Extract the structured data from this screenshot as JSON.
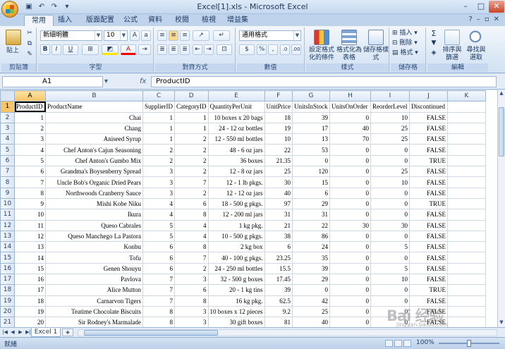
{
  "window": {
    "title": "Excel[1].xls - Microsoft Excel"
  },
  "quick_access": {
    "undo_icon": "undo-icon",
    "redo_icon": "redo-icon"
  },
  "tabs": [
    {
      "label": "常用",
      "active": true
    },
    {
      "label": "插入"
    },
    {
      "label": "版面配置"
    },
    {
      "label": "公式"
    },
    {
      "label": "資料"
    },
    {
      "label": "校閱"
    },
    {
      "label": "檢視"
    },
    {
      "label": "增益集"
    }
  ],
  "ribbon": {
    "clipboard": {
      "label": "剪貼簿",
      "paste": "貼上"
    },
    "font": {
      "label": "字型",
      "font_name": "新細明體",
      "font_size": "10"
    },
    "alignment": {
      "label": "對齊方式"
    },
    "number": {
      "label": "數值",
      "format": "通用格式"
    },
    "styles": {
      "label": "樣式",
      "conditional": "設定格式化的條件",
      "table": "格式化為表格",
      "cell_styles": "儲存格樣式"
    },
    "cells": {
      "label": "儲存格",
      "insert": "插入",
      "delete": "刪除",
      "format": "格式"
    },
    "editing": {
      "label": "編輯",
      "sort": "排序與篩選",
      "find": "尋找與選取"
    }
  },
  "formula_bar": {
    "name_box": "A1",
    "fx": "fx",
    "content": "ProductID"
  },
  "grid": {
    "columns": [
      "A",
      "B",
      "C",
      "D",
      "E",
      "F",
      "G",
      "H",
      "I",
      "J",
      "K"
    ],
    "headers": [
      "ProductID",
      "ProductName",
      "SupplierID",
      "CategoryID",
      "QuantityPerUnit",
      "UnitPrice",
      "UnitsInStock",
      "UnitsOnOrder",
      "ReorderLevel",
      "Discontinued"
    ],
    "rows": [
      [
        "1",
        "Chai",
        "1",
        "1",
        "10 boxes x 20 bags",
        "18",
        "39",
        "0",
        "10",
        "FALSE"
      ],
      [
        "2",
        "Chang",
        "1",
        "1",
        "24 - 12 oz bottles",
        "19",
        "17",
        "40",
        "25",
        "FALSE"
      ],
      [
        "3",
        "Aniseed Syrup",
        "1",
        "2",
        "12 - 550 ml bottles",
        "10",
        "13",
        "70",
        "25",
        "FALSE"
      ],
      [
        "4",
        "Chef Anton's Cajun Seasoning",
        "2",
        "2",
        "48 - 6 oz jars",
        "22",
        "53",
        "0",
        "0",
        "FALSE"
      ],
      [
        "5",
        "Chef Anton's Gumbo Mix",
        "2",
        "2",
        "36 boxes",
        "21.35",
        "0",
        "0",
        "0",
        "TRUE"
      ],
      [
        "6",
        "Grandma's Boysenberry Spread",
        "3",
        "2",
        "12 - 8 oz jars",
        "25",
        "120",
        "0",
        "25",
        "FALSE"
      ],
      [
        "7",
        "Uncle Bob's Organic Dried Pears",
        "3",
        "7",
        "12 - 1 lb pkgs.",
        "30",
        "15",
        "0",
        "10",
        "FALSE"
      ],
      [
        "8",
        "Northwoods Cranberry Sauce",
        "3",
        "2",
        "12 - 12 oz jars",
        "40",
        "6",
        "0",
        "0",
        "FALSE"
      ],
      [
        "9",
        "Mishi Kobe Niku",
        "4",
        "6",
        "18 - 500 g pkgs.",
        "97",
        "29",
        "0",
        "0",
        "TRUE"
      ],
      [
        "10",
        "Ikura",
        "4",
        "8",
        "12 - 200 ml jars",
        "31",
        "31",
        "0",
        "0",
        "FALSE"
      ],
      [
        "11",
        "Queso Cabrales",
        "5",
        "4",
        "1 kg pkg.",
        "21",
        "22",
        "30",
        "30",
        "FALSE"
      ],
      [
        "12",
        "Queso Manchego La Pastora",
        "5",
        "4",
        "10 - 500 g pkgs.",
        "38",
        "86",
        "0",
        "0",
        "FALSE"
      ],
      [
        "13",
        "Konbu",
        "6",
        "8",
        "2 kg box",
        "6",
        "24",
        "0",
        "5",
        "FALSE"
      ],
      [
        "14",
        "Tofu",
        "6",
        "7",
        "40 - 100 g pkgs.",
        "23.25",
        "35",
        "0",
        "0",
        "FALSE"
      ],
      [
        "15",
        "Genen Shouyu",
        "6",
        "2",
        "24 - 250 ml bottles",
        "15.5",
        "39",
        "0",
        "5",
        "FALSE"
      ],
      [
        "16",
        "Pavlova",
        "7",
        "3",
        "32 - 500 g boxes",
        "17.45",
        "29",
        "0",
        "10",
        "FALSE"
      ],
      [
        "17",
        "Alice Mutton",
        "7",
        "6",
        "20 - 1 kg tins",
        "39",
        "0",
        "0",
        "0",
        "TRUE"
      ],
      [
        "18",
        "Carnarvon Tigers",
        "7",
        "8",
        "16 kg pkg.",
        "62.5",
        "42",
        "0",
        "0",
        "FALSE"
      ],
      [
        "19",
        "Teatime Chocolate Biscuits",
        "8",
        "3",
        "10 boxes x 12 pieces",
        "9.2",
        "25",
        "0",
        "0",
        "FALSE"
      ],
      [
        "20",
        "Sir Rodney's Marmalade",
        "8",
        "3",
        "30 gift boxes",
        "81",
        "40",
        "0",
        "0",
        "FALSE"
      ]
    ]
  },
  "sheet_tabs": [
    {
      "label": "Excel 1"
    }
  ],
  "status": {
    "text": "就緒",
    "zoom": "100%"
  },
  "watermark": {
    "main": "Bai 经验",
    "sub": "jingyan.baidu.com"
  }
}
